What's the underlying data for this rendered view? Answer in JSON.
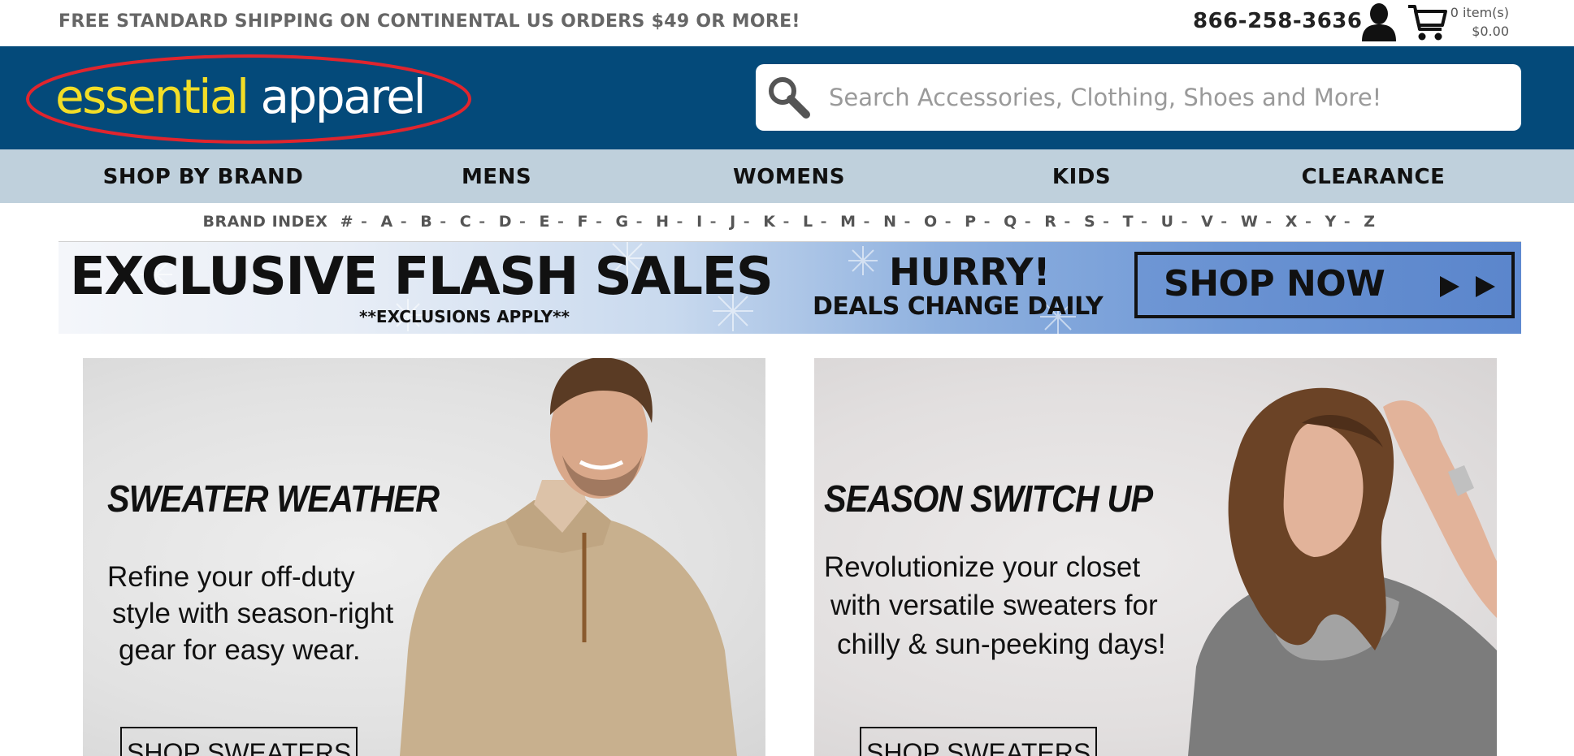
{
  "topbar": {
    "shipping_text": "FREE STANDARD SHIPPING ON CONTINENTAL US ORDERS $49 OR MORE!",
    "phone": "866-258-3636",
    "account_icon": "user-icon",
    "cart_icon": "cart-icon",
    "cart_items": "0 item(s)",
    "cart_total": "$0.00"
  },
  "header": {
    "logo_word1": "essential",
    "logo_word2": "apparel",
    "search_placeholder": "Search Accessories, Clothing, Shoes and More!",
    "search_icon": "search-icon",
    "colors": {
      "header_bg": "#044a7a",
      "logo_yellow": "#f3de27",
      "logo_ellipse": "#e0252e",
      "nav_bg": "#bfd0dc"
    }
  },
  "nav": {
    "items": [
      "SHOP BY BRAND",
      "MENS",
      "WOMENS",
      "KIDS",
      "CLEARANCE"
    ]
  },
  "brand_index": {
    "label": "BRAND INDEX",
    "letters": [
      "#",
      "A",
      "B",
      "C",
      "D",
      "E",
      "F",
      "G",
      "H",
      "I",
      "J",
      "K",
      "L",
      "M",
      "N",
      "O",
      "P",
      "Q",
      "R",
      "S",
      "T",
      "U",
      "V",
      "W",
      "X",
      "Y",
      "Z"
    ]
  },
  "flash_banner": {
    "title": "EXCLUSIVE FLASH SALES",
    "exclusions": "**EXCLUSIONS APPLY**",
    "hurry": "HURRY!",
    "deals": "DEALS CHANGE DAILY",
    "button": "SHOP NOW"
  },
  "promos": [
    {
      "title": "SWEATER WEATHER",
      "lines": [
        "Refine your off-duty",
        "style with season-right",
        "gear for easy wear."
      ],
      "button": "SHOP SWEATERS"
    },
    {
      "title": "SEASON SWITCH UP",
      "lines": [
        "Revolutionize your closet",
        "with versatile sweaters for",
        "chilly & sun-peeking days!"
      ],
      "button": "SHOP SWEATERS"
    }
  ]
}
